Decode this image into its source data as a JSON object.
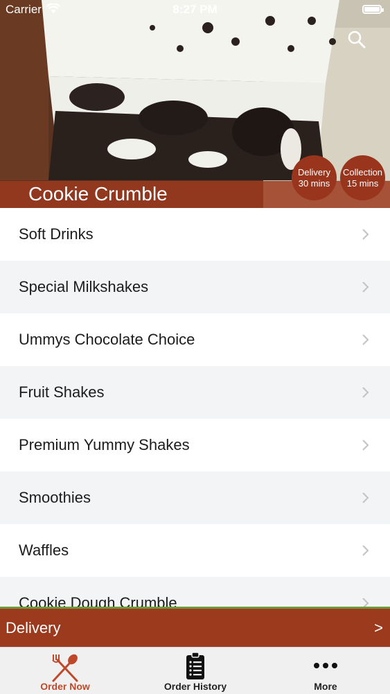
{
  "status_bar": {
    "carrier": "Carrier",
    "time": "8:27 PM"
  },
  "hero": {
    "restaurant_name": "Cookie Crumble",
    "delivery": {
      "label": "Delivery",
      "time": "30 mins"
    },
    "collection": {
      "label": "Collection",
      "time": "15 mins"
    }
  },
  "categories": [
    {
      "label": "Soft Drinks"
    },
    {
      "label": "Special Milkshakes"
    },
    {
      "label": "Ummys Chocolate Choice"
    },
    {
      "label": "Fruit Shakes"
    },
    {
      "label": "Premium Yummy Shakes"
    },
    {
      "label": "Smoothies"
    },
    {
      "label": "Waffles"
    },
    {
      "label": "Cookie Dough Crumble"
    }
  ],
  "delivery_bar": {
    "label": "Delivery",
    "arrow": ">"
  },
  "tabs": [
    {
      "label": "Order Now",
      "icon": "fork-knife-icon"
    },
    {
      "label": "Order History",
      "icon": "clipboard-list-icon"
    },
    {
      "label": "More",
      "icon": "more-dots-icon"
    }
  ],
  "colors": {
    "accent": "#9b3a1d",
    "active_tab": "#c0482a",
    "delivery_border": "#6f9a3a"
  }
}
